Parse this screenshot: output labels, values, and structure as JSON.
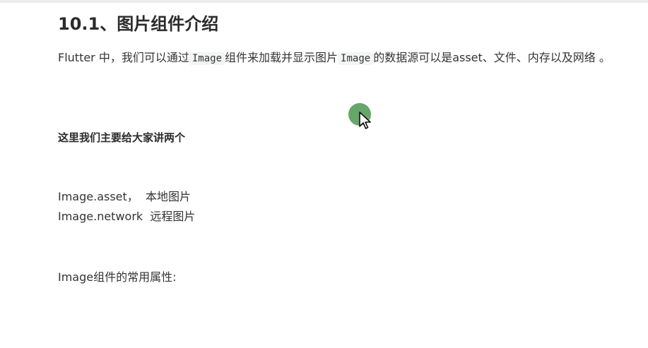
{
  "heading": "10.1、图片组件介绍",
  "intro": {
    "part1": "Flutter 中，我们可以通过",
    "code1": "Image",
    "part2": "组件来加载并显示图片",
    "code2": "Image",
    "part3": "的数据源可以是asset、文件、内存以及网络 。"
  },
  "subheading": "这里我们主要给大家讲两个",
  "items": [
    "Image.asset，  本地图片",
    "Image.network  远程图片"
  ],
  "properties_heading": "Image组件的常用属性:",
  "colors": {
    "cursor_highlight": "#5a9e5c",
    "code_background": "#f3f4f4"
  },
  "icons": {
    "pointer": "mouse-pointer-icon"
  }
}
